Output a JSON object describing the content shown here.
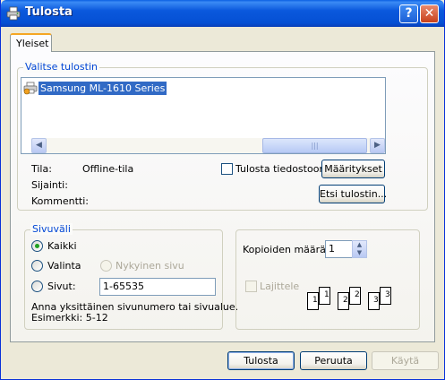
{
  "window": {
    "title": "Tulosta",
    "help_button": "?",
    "close_button": "✕"
  },
  "tabs": [
    {
      "label": "Yleiset"
    }
  ],
  "printer_group": {
    "legend": "Valitse tulostin",
    "printers": [
      {
        "name": "Samsung ML-1610 Series",
        "selected": true
      }
    ],
    "status_label": "Tila:",
    "status_value": "Offline-tila",
    "location_label": "Sijainti:",
    "location_value": "",
    "comment_label": "Kommentti:",
    "comment_value": "",
    "print_to_file_label": "Tulosta tiedostoon",
    "print_to_file_checked": false,
    "preferences_button": "Määritykset",
    "find_printer_button": "Etsi tulostin..."
  },
  "page_range": {
    "legend": "Sivuväli",
    "all_label": "Kaikki",
    "selection_label": "Valinta",
    "current_page_label": "Nykyinen sivu",
    "pages_label": "Sivut:",
    "pages_value": "1-65535",
    "selected_option": "all",
    "help_text_line1": "Anna yksittäinen sivunumero tai sivualue.",
    "help_text_line2": "Esimerkki: 5-12"
  },
  "copies": {
    "label": "Kopioiden määrä:",
    "value": "1",
    "collate_label": "Lajittele",
    "collate_checked": false,
    "collate_pages": [
      "1",
      "1",
      "2",
      "2",
      "3",
      "3"
    ]
  },
  "footer": {
    "print_button": "Tulosta",
    "cancel_button": "Peruuta",
    "apply_button": "Käytä"
  }
}
